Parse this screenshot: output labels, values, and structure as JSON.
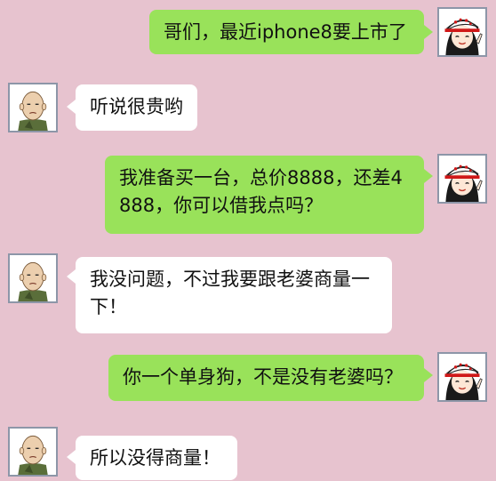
{
  "colors": {
    "background": "#e7c3cf",
    "my_bubble": "#99e25a",
    "their_bubble": "#ffffff",
    "avatar_border": "#8d96a8"
  },
  "messages": [
    {
      "sender": "me",
      "avatar": "girl-cap-avatar-icon",
      "text": "哥们，最近iphone8要上市了"
    },
    {
      "sender": "them",
      "avatar": "bald-man-avatar-icon",
      "text": "听说很贵哟"
    },
    {
      "sender": "me",
      "avatar": "girl-cap-avatar-icon",
      "line1": "我准备买一台，总价8888，还差4",
      "line2": "888，你可以借我点吗？"
    },
    {
      "sender": "them",
      "avatar": "bald-man-avatar-icon",
      "line1": "我没问题，不过我要跟老婆商量一",
      "line2": "下！"
    },
    {
      "sender": "me",
      "avatar": "girl-cap-avatar-icon",
      "text": "你一个单身狗，不是没有老婆吗？"
    },
    {
      "sender": "them",
      "avatar": "bald-man-avatar-icon",
      "text": "所以没得商量！"
    }
  ]
}
